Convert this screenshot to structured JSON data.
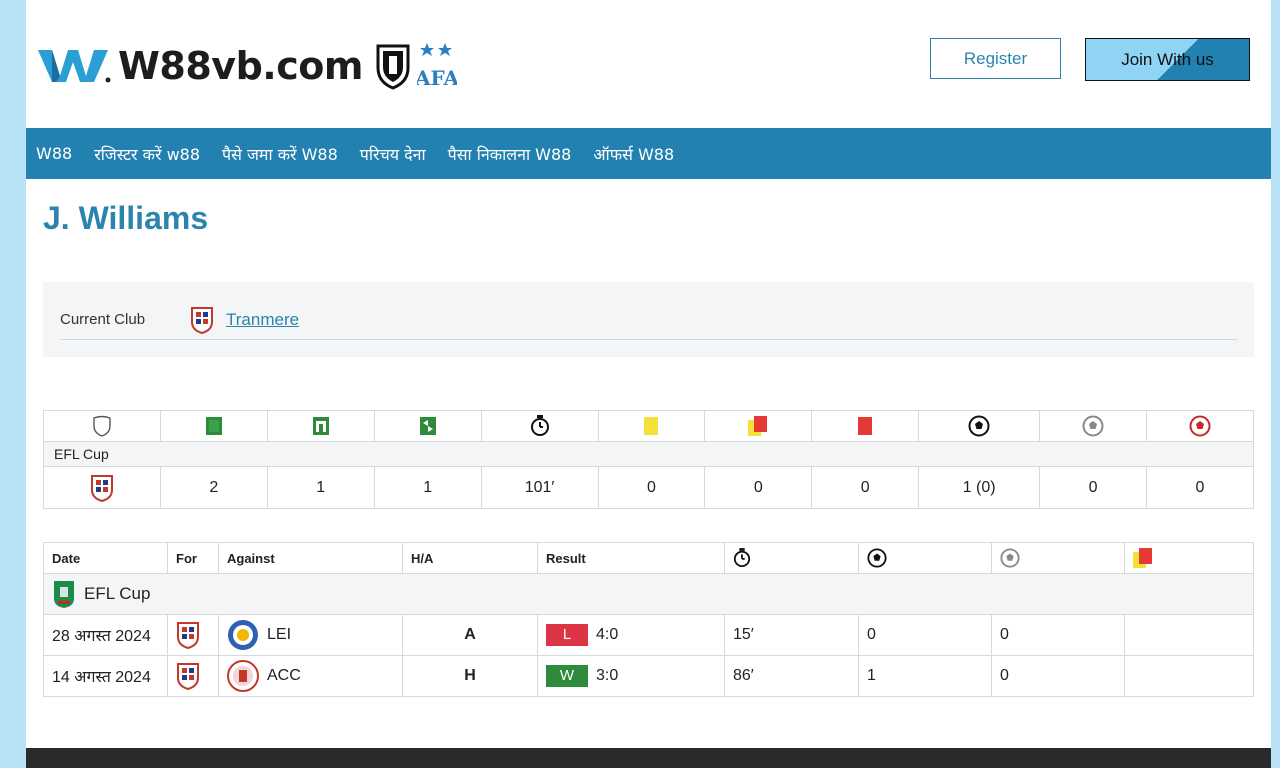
{
  "header": {
    "logo_text": "W88vb.com",
    "logo_afa_text": "AFA",
    "register_label": "Register",
    "join_label": "Join With us"
  },
  "nav": {
    "items": [
      "W88",
      "रजिस्टर करें w88",
      "पैसे जमा करें W88",
      "परिचय देना",
      "पैसा निकालना W88",
      "ऑफर्स W88"
    ]
  },
  "player": {
    "name": "J. Williams",
    "current_club_label": "Current Club",
    "current_club": "Tranmere"
  },
  "stats": {
    "header_icons": [
      "shield-icon",
      "shirt-icon",
      "sub-in-icon",
      "sub-out-icon",
      "stopwatch-icon",
      "yellow-card-icon",
      "second-yellow-icon",
      "red-card-icon",
      "ball-icon",
      "penalty-miss-icon",
      "own-goal-icon"
    ],
    "competition": "EFL Cup",
    "values": [
      "2",
      "1",
      "1",
      "101′",
      "0",
      "0",
      "0",
      "1 (0)",
      "0",
      "0"
    ]
  },
  "matches": {
    "headers": {
      "date": "Date",
      "for": "For",
      "against": "Against",
      "ha": "H/A",
      "result": "Result"
    },
    "competition": "EFL Cup",
    "rows": [
      {
        "date": "28 अगस्त 2024",
        "against": "LEI",
        "ha": "A",
        "outcome": "L",
        "score": "4:0",
        "minutes": "15′",
        "goals": "0",
        "assists": "0"
      },
      {
        "date": "14 अगस्त 2024",
        "against": "ACC",
        "ha": "H",
        "outcome": "W",
        "score": "3:0",
        "minutes": "86′",
        "goals": "1",
        "assists": "0"
      }
    ]
  },
  "colors": {
    "brand": "#2381b1",
    "link": "#2b84ad",
    "loss": "#dc3545",
    "win": "#2e8b3c",
    "background": "#b8e3f7"
  }
}
